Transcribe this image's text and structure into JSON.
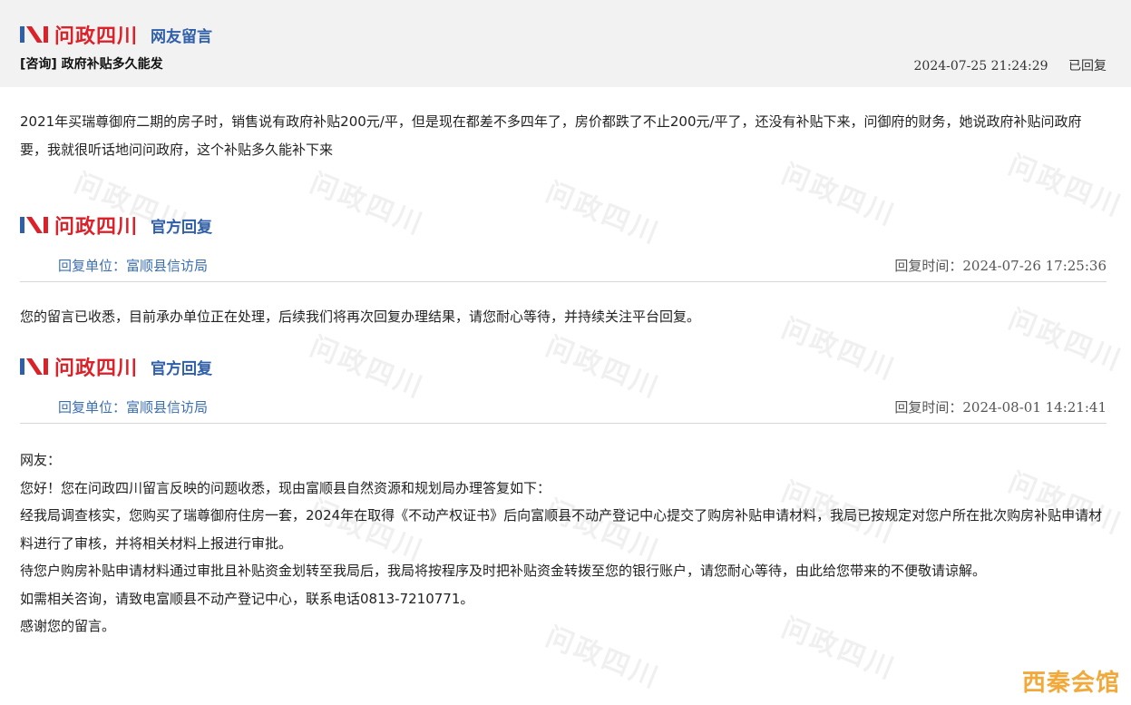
{
  "brand": {
    "logo_text": "问政四川",
    "colors": {
      "brand_red": "#d9222a",
      "brand_blue": "#2f5fa8",
      "accent_link": "#3b6fb0"
    }
  },
  "message": {
    "section_label": "网友留言",
    "category": "[咨询]",
    "title": "政府补贴多久能发",
    "time": "2024-07-25 21:24:29",
    "status": "已回复",
    "body": "2021年买瑞尊御府二期的房子时，销售说有政府补贴200元/平，但是现在都差不多四年了，房价都跌了不止200元/平了，还没有补贴下来，问御府的财务，她说政府补贴问政府要，我就很听话地问问政府，这个补贴多久能补下来"
  },
  "replies": [
    {
      "section_label": "官方回复",
      "unit_label": "回复单位：富顺县信访局",
      "time_label": "回复时间：",
      "time": "2024-07-26 17:25:36",
      "body": "您的留言已收悉，目前承办单位正在处理，后续我们将再次回复办理结果，请您耐心等待，并持续关注平台回复。"
    },
    {
      "section_label": "官方回复",
      "unit_label": "回复单位：富顺县信访局",
      "time_label": "回复时间：",
      "time": "2024-08-01 14:21:41",
      "body_lines": [
        "网友：",
        "您好！您在问政四川留言反映的问题收悉，现由富顺县自然资源和规划局办理答复如下：",
        "经我局调查核实，您购买了瑞尊御府住房一套，2024年在取得《不动产权证书》后向富顺县不动产登记中心提交了购房补贴申请材料，我局已按规定对您户所在批次购房补贴申请材料进行了审核，并将相关材料上报进行审批。",
        "待您户购房补贴申请材料通过审批且补贴资金划转至我局后，我局将按程序及时把补贴资金转拨至您的银行账户，请您耐心等待，由此给您带来的不便敬请谅解。",
        "如需相关咨询，请致电富顺县不动产登记中心，联系电话0813-7210771。",
        "感谢您的留言。"
      ]
    }
  ],
  "watermark_text": "问政四川",
  "corner_logo": "西秦会馆"
}
